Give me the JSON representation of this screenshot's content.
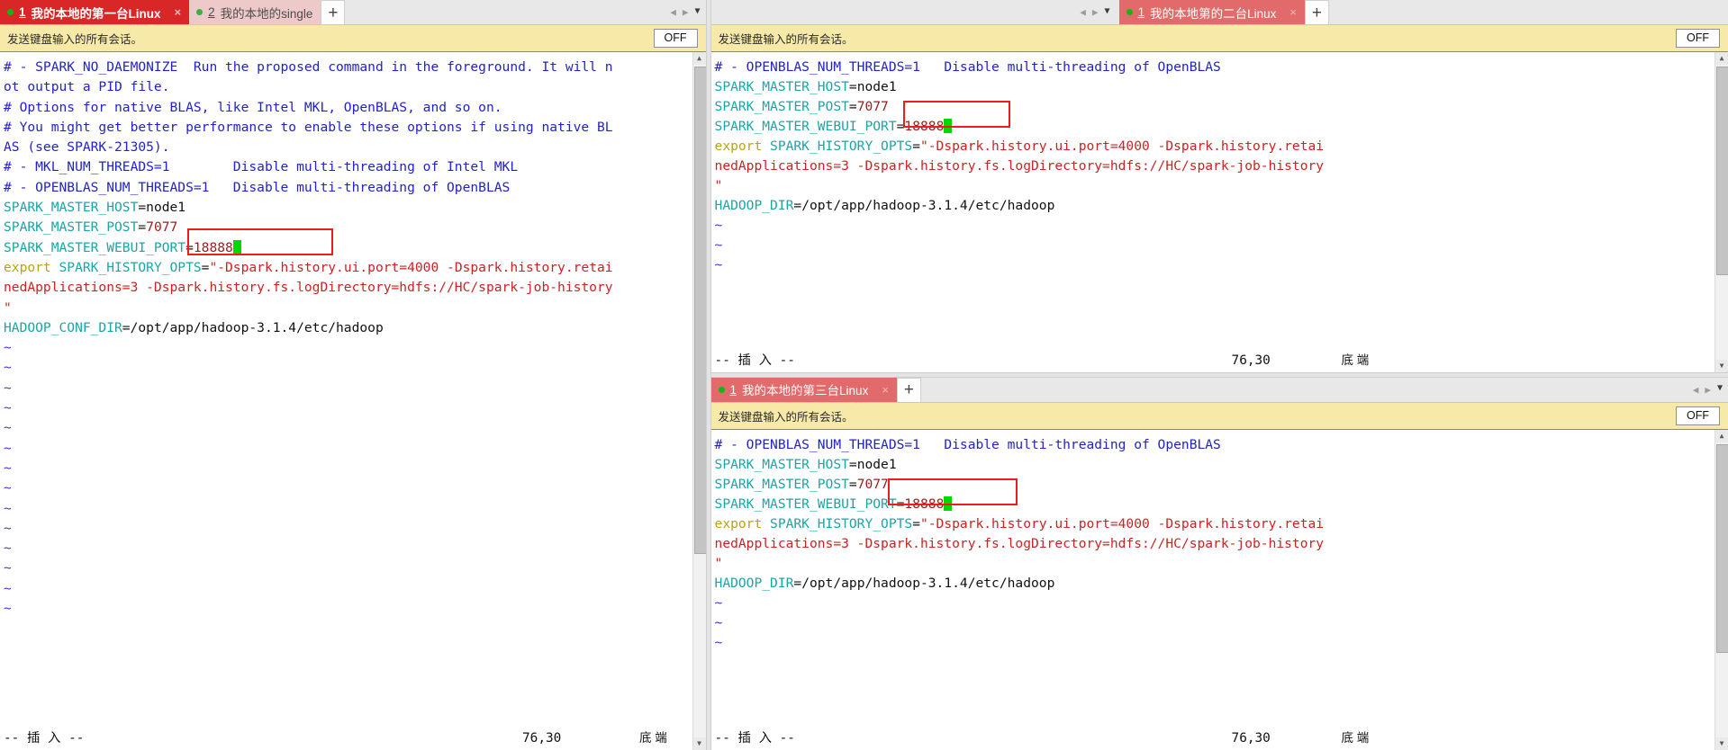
{
  "app": {
    "keystrip_label": "发送键盘输入的所有会话。",
    "off_label": "OFF",
    "plus_label": "+",
    "close_glyph": "×",
    "nav_left_glyph": "◀",
    "nav_right_glyph": "▶",
    "nav_drop_glyph": "▼",
    "colors": {
      "tab_active": "#d92626",
      "tab_inactive": "#edc9c9",
      "keystrip_bg": "#f7eaa8",
      "highlight_box": "#ee1c1c",
      "cursor": "#00d900",
      "comment": "#2222cc",
      "variable": "#1aa6a6",
      "number": "#9e1b1b",
      "keyword": "#b8a316",
      "string": "#cc2222",
      "tilde": "#3b3bd6"
    }
  },
  "panel1": {
    "tabs": [
      {
        "num": "1",
        "title": "我的本地的第一台Linux",
        "active": true,
        "has_close": true
      },
      {
        "num": "2",
        "title": "我的本地的single",
        "active": false,
        "has_close": false
      }
    ],
    "lines": [
      [
        {
          "t": "# - SPARK_NO_DAEMONIZE  Run the proposed command in the foreground. It will n",
          "c": "c-comment"
        }
      ],
      [
        {
          "t": "ot output a PID file.",
          "c": "c-comment"
        }
      ],
      [
        {
          "t": "# Options for native BLAS, like Intel MKL, OpenBLAS, and so on.",
          "c": "c-comment"
        }
      ],
      [
        {
          "t": "# You might get better performance to enable these options if using native BL",
          "c": "c-comment"
        }
      ],
      [
        {
          "t": "AS (see SPARK-21305).",
          "c": "c-comment"
        }
      ],
      [
        {
          "t": "# - MKL_NUM_THREADS=1        Disable multi-threading of Intel MKL",
          "c": "c-comment"
        }
      ],
      [
        {
          "t": "# - OPENBLAS_NUM_THREADS=1   Disable multi-threading of OpenBLAS",
          "c": "c-comment"
        }
      ],
      [
        {
          "t": "SPARK_MASTER_HOST",
          "c": "c-var"
        },
        {
          "t": "=node1",
          "c": "c-plain"
        }
      ],
      [
        {
          "t": "SPARK_MASTER_POST",
          "c": "c-var"
        },
        {
          "t": "=",
          "c": "c-plain"
        },
        {
          "t": "7077",
          "c": "c-num"
        }
      ],
      [
        {
          "t": "SPARK_MASTER_WEBUI_PORT",
          "c": "c-var"
        },
        {
          "t": "=",
          "c": "c-plain"
        },
        {
          "t": "18888",
          "c": "c-num"
        },
        {
          "t": "█",
          "c": "cursorcell"
        }
      ],
      [
        {
          "t": "export",
          "c": "c-kw"
        },
        {
          "t": " SPARK_HISTORY_OPTS",
          "c": "c-var"
        },
        {
          "t": "=",
          "c": "c-plain"
        },
        {
          "t": "\"-Dspark.history.ui.port=4000 -Dspark.history.retai",
          "c": "c-str"
        }
      ],
      [
        {
          "t": "nedApplications=3 -Dspark.history.fs.logDirectory=hdfs://HC/spark-job-history",
          "c": "c-str"
        }
      ],
      [
        {
          "t": "\"",
          "c": "c-str"
        }
      ],
      [
        {
          "t": "HADOOP_CONF_DIR",
          "c": "c-var"
        },
        {
          "t": "=/opt/app/hadoop-3.1.4/etc/hadoop",
          "c": "c-plain"
        }
      ],
      [
        {
          "t": "~",
          "c": "c-tilde"
        }
      ],
      [
        {
          "t": "~",
          "c": "c-tilde"
        }
      ],
      [
        {
          "t": "~",
          "c": "c-tilde"
        }
      ],
      [
        {
          "t": "~",
          "c": "c-tilde"
        }
      ],
      [
        {
          "t": "~",
          "c": "c-tilde"
        }
      ],
      [
        {
          "t": "~",
          "c": "c-tilde"
        }
      ],
      [
        {
          "t": "~",
          "c": "c-tilde"
        }
      ],
      [
        {
          "t": "~",
          "c": "c-tilde"
        }
      ],
      [
        {
          "t": "~",
          "c": "c-tilde"
        }
      ],
      [
        {
          "t": "~",
          "c": "c-tilde"
        }
      ],
      [
        {
          "t": "~",
          "c": "c-tilde"
        }
      ],
      [
        {
          "t": "~",
          "c": "c-tilde"
        }
      ],
      [
        {
          "t": "~",
          "c": "c-tilde"
        }
      ],
      [
        {
          "t": "~",
          "c": "c-tilde"
        }
      ]
    ],
    "status": {
      "mode": "-- 插 入 --",
      "position": "76,30",
      "location": "底 端"
    }
  },
  "panel2": {
    "tabs": [
      {
        "num": "1",
        "title": "我的本地第的二台Linux",
        "active": true,
        "has_close": true
      }
    ],
    "lines": [
      [
        {
          "t": "# - OPENBLAS_NUM_THREADS=1   Disable multi-threading of OpenBLAS",
          "c": "c-comment"
        }
      ],
      [
        {
          "t": "SPARK_MASTER_HOST",
          "c": "c-var"
        },
        {
          "t": "=node1",
          "c": "c-plain"
        }
      ],
      [
        {
          "t": "SPARK_MASTER_POST",
          "c": "c-var"
        },
        {
          "t": "=",
          "c": "c-plain"
        },
        {
          "t": "7077",
          "c": "c-num"
        }
      ],
      [
        {
          "t": "SPARK_MASTER_WEBUI_PORT",
          "c": "c-var"
        },
        {
          "t": "=",
          "c": "c-plain"
        },
        {
          "t": "18888",
          "c": "c-num"
        },
        {
          "t": "█",
          "c": "cursorcell"
        }
      ],
      [
        {
          "t": "export",
          "c": "c-kw"
        },
        {
          "t": " SPARK_HISTORY_OPTS",
          "c": "c-var"
        },
        {
          "t": "=",
          "c": "c-plain"
        },
        {
          "t": "\"-Dspark.history.ui.port=4000 -Dspark.history.retai",
          "c": "c-str"
        }
      ],
      [
        {
          "t": "nedApplications=3 -Dspark.history.fs.logDirectory=hdfs://HC/spark-job-history",
          "c": "c-str"
        }
      ],
      [
        {
          "t": "\"",
          "c": "c-str"
        }
      ],
      [
        {
          "t": "HADOOP_DIR",
          "c": "c-var"
        },
        {
          "t": "=/opt/app/hadoop-3.1.4/etc/hadoop",
          "c": "c-plain"
        }
      ],
      [
        {
          "t": "~",
          "c": "c-tilde"
        }
      ],
      [
        {
          "t": "~",
          "c": "c-tilde"
        }
      ],
      [
        {
          "t": "~",
          "c": "c-tilde"
        }
      ]
    ],
    "status": {
      "mode": "-- 插 入 --",
      "position": "76,30",
      "location": "底 端"
    }
  },
  "panel3": {
    "tabs": [
      {
        "num": "1",
        "title": "我的本地的第三台Linux",
        "active": true,
        "has_close": true
      }
    ],
    "lines": [
      [
        {
          "t": "# - OPENBLAS_NUM_THREADS=1   Disable multi-threading of OpenBLAS",
          "c": "c-comment"
        }
      ],
      [
        {
          "t": "SPARK_MASTER_HOST",
          "c": "c-var"
        },
        {
          "t": "=node1",
          "c": "c-plain"
        }
      ],
      [
        {
          "t": "SPARK_MASTER_POST",
          "c": "c-var"
        },
        {
          "t": "=",
          "c": "c-plain"
        },
        {
          "t": "7077",
          "c": "c-num"
        }
      ],
      [
        {
          "t": "SPARK_MASTER_WEBUI_PORT",
          "c": "c-var"
        },
        {
          "t": "=",
          "c": "c-plain"
        },
        {
          "t": "18888",
          "c": "c-num"
        },
        {
          "t": "█",
          "c": "cursorcell"
        }
      ],
      [
        {
          "t": "export",
          "c": "c-kw"
        },
        {
          "t": " SPARK_HISTORY_OPTS",
          "c": "c-var"
        },
        {
          "t": "=",
          "c": "c-plain"
        },
        {
          "t": "\"-Dspark.history.ui.port=4000 -Dspark.history.retai",
          "c": "c-str"
        }
      ],
      [
        {
          "t": "nedApplications=3 -Dspark.history.fs.logDirectory=hdfs://HC/spark-job-history",
          "c": "c-str"
        }
      ],
      [
        {
          "t": "\"",
          "c": "c-str"
        }
      ],
      [
        {
          "t": "HADOOP_DIR",
          "c": "c-var"
        },
        {
          "t": "=/opt/app/hadoop-3.1.4/etc/hadoop",
          "c": "c-plain"
        }
      ],
      [
        {
          "t": "~",
          "c": "c-tilde"
        }
      ],
      [
        {
          "t": "~",
          "c": "c-tilde"
        }
      ],
      [
        {
          "t": "~",
          "c": "c-tilde"
        }
      ]
    ],
    "status": {
      "mode": "-- 插 入 --",
      "position": "76,30",
      "location": "底 端"
    }
  }
}
